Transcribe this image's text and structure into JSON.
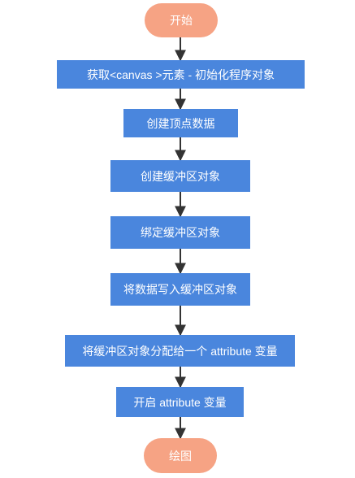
{
  "flowchart": {
    "start": "开始",
    "steps": [
      "获取<canvas >元素 - 初始化程序对象",
      "创建顶点数据",
      "创建缓冲区对象",
      "绑定缓冲区对象",
      "将数据写入缓冲区对象",
      "将缓冲区对象分配给一个 attribute 变量",
      "开启 attribute 变量"
    ],
    "end": "绘图"
  },
  "colors": {
    "terminal": "#f6a384",
    "process": "#4a86dd",
    "arrow": "#333333"
  }
}
